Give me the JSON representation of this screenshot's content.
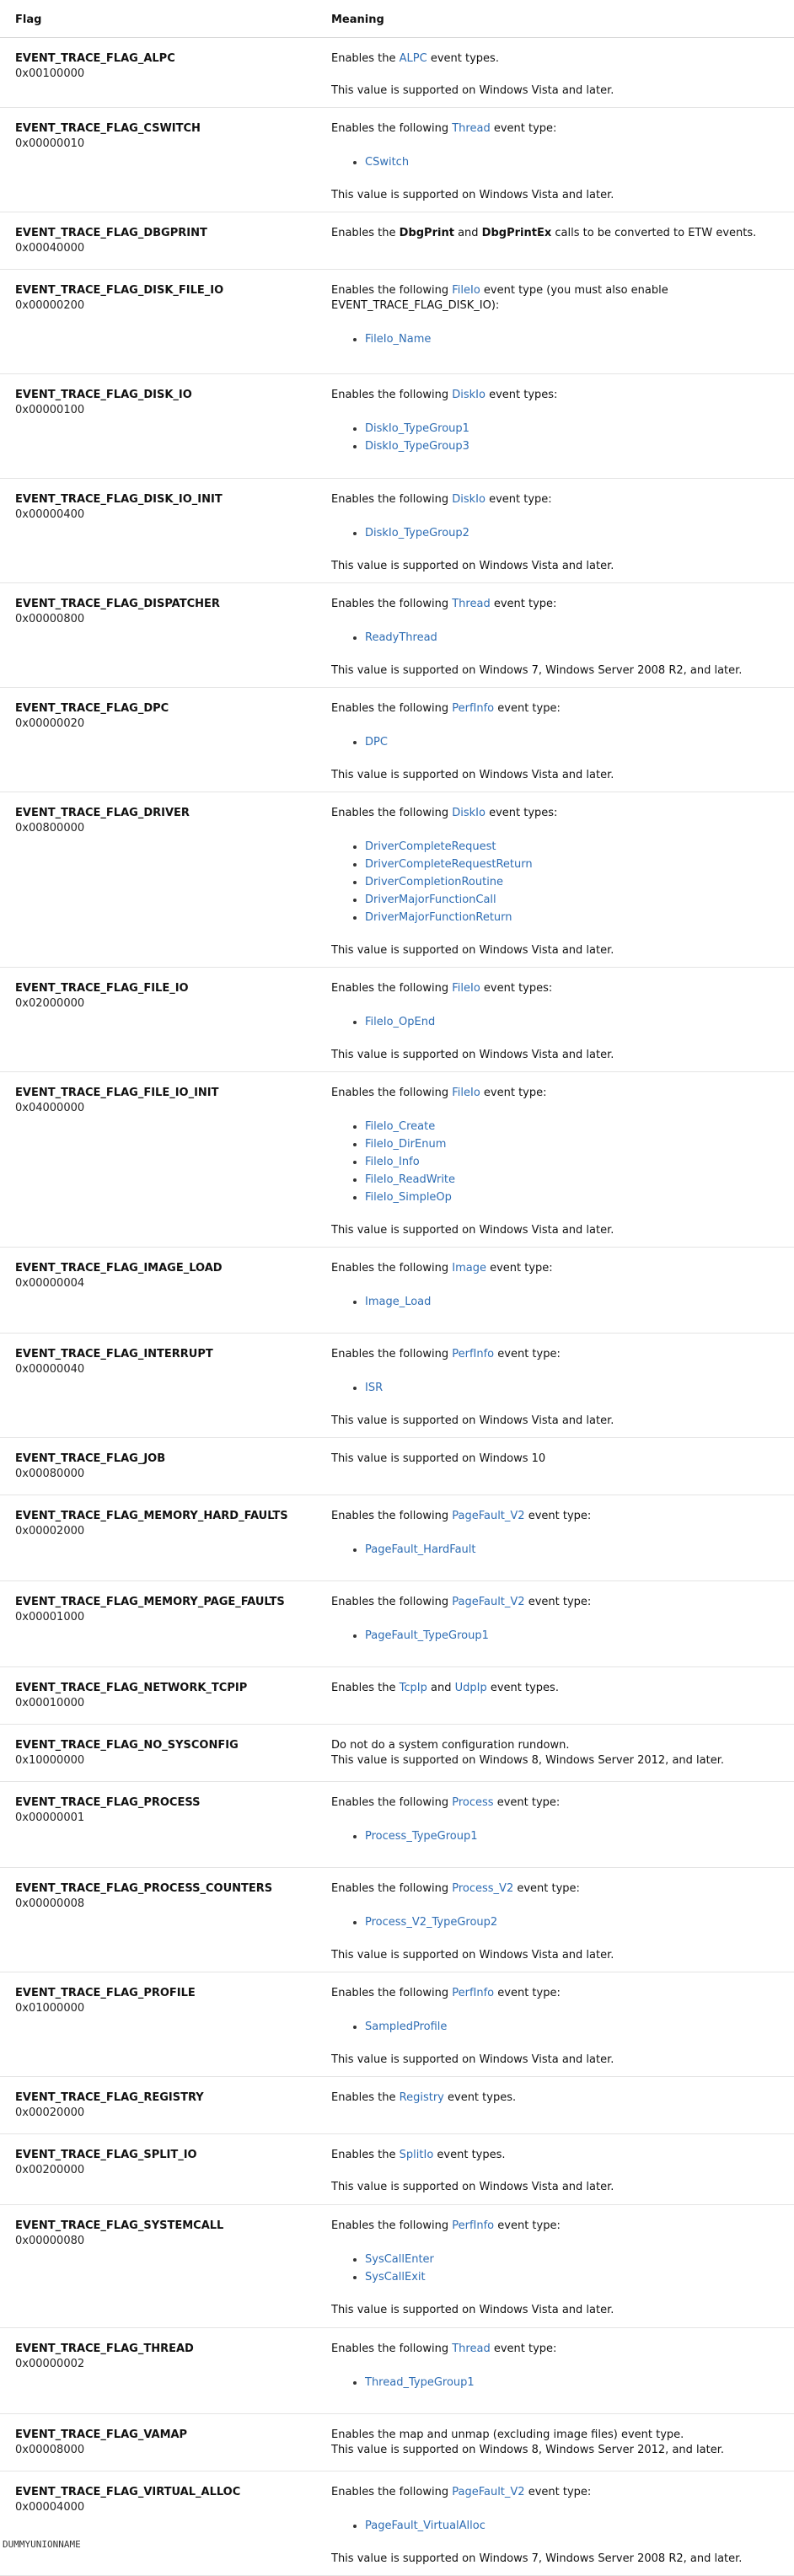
{
  "header": {
    "flag": "Flag",
    "meaning": "Meaning"
  },
  "rows": [
    {
      "name": "EVENT_TRACE_FLAG_ALPC",
      "value": "0x00100000",
      "pre": "Enables the ",
      "link": "ALPC",
      "post": " event types.",
      "events": [],
      "note": "This value is supported on Windows Vista and later."
    },
    {
      "name": "EVENT_TRACE_FLAG_CSWITCH",
      "value": "0x00000010",
      "pre": "Enables the following ",
      "link": "Thread",
      "post": " event type:",
      "events": [
        "CSwitch"
      ],
      "note": "This value is supported on Windows Vista and later."
    },
    {
      "name": "EVENT_TRACE_FLAG_DBGPRINT",
      "value": "0x00040000",
      "pre": "Enables the ",
      "bold1": "DbgPrint",
      "mid": " and ",
      "bold2": "DbgPrintEx",
      "post": " calls to be converted to ETW events.",
      "events": [],
      "note": ""
    },
    {
      "name": "EVENT_TRACE_FLAG_DISK_FILE_IO",
      "value": "0x00000200",
      "pre": "Enables the following ",
      "link": "FileIo",
      "post": " event type (you must also enable",
      "line2": "EVENT_TRACE_FLAG_DISK_IO):",
      "events": [
        "FileIo_Name"
      ],
      "note": ""
    },
    {
      "name": "EVENT_TRACE_FLAG_DISK_IO",
      "value": "0x00000100",
      "pre": "Enables the following ",
      "link": "DiskIo",
      "post": " event types:",
      "events": [
        "DiskIo_TypeGroup1",
        "DiskIo_TypeGroup3"
      ],
      "note": ""
    },
    {
      "name": "EVENT_TRACE_FLAG_DISK_IO_INIT",
      "value": "0x00000400",
      "pre": "Enables the following ",
      "link": "DiskIo",
      "post": " event type:",
      "events": [
        "DiskIo_TypeGroup2"
      ],
      "note": "This value is supported on Windows Vista and later."
    },
    {
      "name": "EVENT_TRACE_FLAG_DISPATCHER",
      "value": "0x00000800",
      "pre": "Enables the following ",
      "link": "Thread",
      "post": " event type:",
      "events": [
        "ReadyThread"
      ],
      "note": "This value is supported on Windows 7, Windows Server 2008 R2, and later."
    },
    {
      "name": "EVENT_TRACE_FLAG_DPC",
      "value": "0x00000020",
      "pre": "Enables the following ",
      "link": "PerfInfo",
      "post": " event type:",
      "events": [
        "DPC"
      ],
      "note": "This value is supported on Windows Vista and later."
    },
    {
      "name": "EVENT_TRACE_FLAG_DRIVER",
      "value": "0x00800000",
      "pre": "Enables the following ",
      "link": "DiskIo",
      "post": " event types:",
      "events": [
        "DriverCompleteRequest",
        "DriverCompleteRequestReturn",
        "DriverCompletionRoutine",
        "DriverMajorFunctionCall",
        "DriverMajorFunctionReturn"
      ],
      "note": "This value is supported on Windows Vista and later."
    },
    {
      "name": "EVENT_TRACE_FLAG_FILE_IO",
      "value": "0x02000000",
      "pre": "Enables the following ",
      "link": "FileIo",
      "post": " event types:",
      "events": [
        "FileIo_OpEnd"
      ],
      "note": "This value is supported on Windows Vista and later."
    },
    {
      "name": "EVENT_TRACE_FLAG_FILE_IO_INIT",
      "value": "0x04000000",
      "pre": "Enables the following ",
      "link": "FileIo",
      "post": " event type:",
      "events": [
        "FileIo_Create",
        "FileIo_DirEnum",
        "FileIo_Info",
        "FileIo_ReadWrite",
        "FileIo_SimpleOp"
      ],
      "note": "This value is supported on Windows Vista and later."
    },
    {
      "name": "EVENT_TRACE_FLAG_IMAGE_LOAD",
      "value": "0x00000004",
      "pre": "Enables the following ",
      "link": "Image",
      "post": " event type:",
      "events": [
        "Image_Load"
      ],
      "note": ""
    },
    {
      "name": "EVENT_TRACE_FLAG_INTERRUPT",
      "value": "0x00000040",
      "pre": "Enables the following ",
      "link": "PerfInfo",
      "post": " event type:",
      "events": [
        "ISR"
      ],
      "note": "This value is supported on Windows Vista and later."
    },
    {
      "name": "EVENT_TRACE_FLAG_JOB",
      "value": "0x00080000",
      "pre": "This value is supported on Windows 10",
      "events": [],
      "note": ""
    },
    {
      "name": "EVENT_TRACE_FLAG_MEMORY_HARD_FAULTS",
      "value": "0x00002000",
      "pre": "Enables the following ",
      "link": "PageFault_V2",
      "post": " event type:",
      "events": [
        "PageFault_HardFault"
      ],
      "note": ""
    },
    {
      "name": "EVENT_TRACE_FLAG_MEMORY_PAGE_FAULTS",
      "value": "0x00001000",
      "pre": "Enables the following ",
      "link": "PageFault_V2",
      "post": " event type:",
      "events": [
        "PageFault_TypeGroup1"
      ],
      "note": ""
    },
    {
      "name": "EVENT_TRACE_FLAG_NETWORK_TCPIP",
      "value": "0x00010000",
      "pre": "Enables the ",
      "link": "TcpIp",
      "mid": " and ",
      "link2": "UdpIp",
      "post": " event types.",
      "events": [],
      "note": ""
    },
    {
      "name": "EVENT_TRACE_FLAG_NO_SYSCONFIG",
      "value": "0x10000000",
      "pre": "Do not do a system configuration rundown.",
      "events": [],
      "tightnote": "This value is supported on Windows 8, Windows Server 2012, and later."
    },
    {
      "name": "EVENT_TRACE_FLAG_PROCESS",
      "value": "0x00000001",
      "pre": "Enables the following ",
      "link": "Process",
      "post": " event type:",
      "events": [
        "Process_TypeGroup1"
      ],
      "note": ""
    },
    {
      "name": "EVENT_TRACE_FLAG_PROCESS_COUNTERS",
      "value": "0x00000008",
      "pre": "Enables the following ",
      "link": "Process_V2",
      "post": " event type:",
      "events": [
        "Process_V2_TypeGroup2"
      ],
      "note": "This value is supported on Windows Vista and later."
    },
    {
      "name": "EVENT_TRACE_FLAG_PROFILE",
      "value": "0x01000000",
      "pre": "Enables the following ",
      "link": "PerfInfo",
      "post": " event type:",
      "events": [
        "SampledProfile"
      ],
      "note": "This value is supported on Windows Vista and later."
    },
    {
      "name": "EVENT_TRACE_FLAG_REGISTRY",
      "value": "0x00020000",
      "pre": "Enables the ",
      "link": "Registry",
      "post": " event types.",
      "events": [],
      "note": ""
    },
    {
      "name": "EVENT_TRACE_FLAG_SPLIT_IO",
      "value": "0x00200000",
      "pre": "Enables the ",
      "link": "SplitIo",
      "post": " event types.",
      "events": [],
      "note": "This value is supported on Windows Vista and later."
    },
    {
      "name": "EVENT_TRACE_FLAG_SYSTEMCALL",
      "value": "0x00000080",
      "pre": "Enables the following ",
      "link": "PerfInfo",
      "post": " event type:",
      "events": [
        "SysCallEnter",
        "SysCallExit"
      ],
      "note": "This value is supported on Windows Vista and later."
    },
    {
      "name": "EVENT_TRACE_FLAG_THREAD",
      "value": "0x00000002",
      "pre": "Enables the following ",
      "link": "Thread",
      "post": " event type:",
      "events": [
        "Thread_TypeGroup1"
      ],
      "note": ""
    },
    {
      "name": "EVENT_TRACE_FLAG_VAMAP",
      "value": "0x00008000",
      "pre": "Enables the map and unmap (excluding image files) event type.",
      "events": [],
      "tightnote": "This value is supported on Windows 8, Windows Server 2012, and later."
    },
    {
      "name": "EVENT_TRACE_FLAG_VIRTUAL_ALLOC",
      "value": "0x00004000",
      "pre": "Enables the following ",
      "link": "PageFault_V2",
      "post": " event type:",
      "events": [
        "PageFault_VirtualAlloc"
      ],
      "note": "This value is supported on Windows 7, Windows Server 2008 R2, and later."
    }
  ],
  "footer": "DUMMYUNIONNAME"
}
